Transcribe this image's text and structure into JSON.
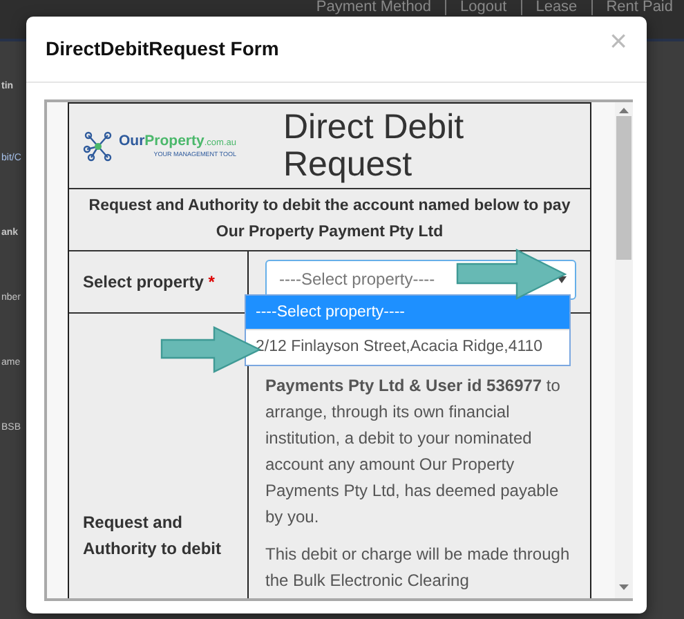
{
  "background_page": {
    "nav_links": [
      "Payment Method",
      "Logout",
      "Lease",
      "Rent Paid"
    ],
    "fragments": [
      {
        "text": "tin",
        "kind": "heading"
      },
      {
        "text": "bit/C",
        "kind": "link"
      },
      {
        "text": "ank",
        "kind": "heading"
      },
      {
        "text": "nber",
        "kind": "label"
      },
      {
        "text": "ame",
        "kind": "label"
      },
      {
        "text": "BSB",
        "kind": "label"
      }
    ]
  },
  "modal": {
    "title": "DirectDebitRequest Form",
    "close": "×"
  },
  "form": {
    "logo": {
      "brand_first": "Our",
      "brand_second": "Property",
      "domain": ".com.au",
      "tagline": "YOUR MANAGEMENT TOOL"
    },
    "heading": "Direct Debit Request",
    "subheading": "Request and Authority to debit the account named below to pay Our Property Payment Pty Ltd",
    "select_label": "Select property",
    "required_mark": "*",
    "select": {
      "value": "----Select property----",
      "expanded": true,
      "options": [
        {
          "label": "----Select property----",
          "selected": true
        },
        {
          "label": "2/12 Finlayson Street,Acacia Ridge,4110",
          "selected": false
        }
      ]
    },
    "authority_label": "Request and Authority to debit",
    "authority_paragraphs": [
      "**Payments Pty Ltd & User id 536977** to arrange, through its own financial institution, a debit to your nominated account any amount Our Property Payments Pty Ltd, has deemed payable by you.",
      "This debit or charge will be made through the Bulk Electronic Clearing"
    ]
  }
}
